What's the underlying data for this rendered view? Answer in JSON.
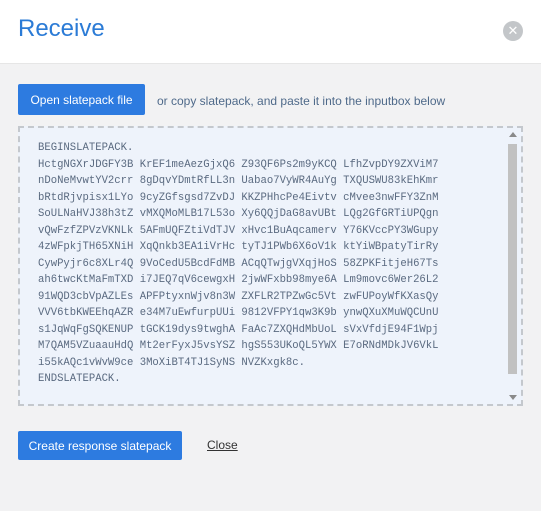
{
  "dialog": {
    "title": "Receive",
    "close_icon": "close-icon"
  },
  "actions": {
    "open_label": "Open slatepack file",
    "hint": "or copy slatepack, and paste it into the inputbox below",
    "create_label": "Create response slatepack",
    "close_label": "Close"
  },
  "inputbox": {
    "lines": [
      "BEGINSLATEPACK.",
      "HctgNGXrJDGFY3B KrEF1meAezGjxQ6 Z93QF6Ps2m9yKCQ LfhZvpDY9ZXViM7",
      "nDoNeMvwtYV2crr 8gDqvYDmtRfLL3n Uabao7VyWR4AuYg TXQUSWU83kEhKmr",
      "bRtdRjvpisx1LYo 9cyZGfsgsd7ZvDJ KKZPHhcPe4Eivtv cMvee3nwFFY3ZnM",
      "SoULNaHVJ38h3tZ vMXQMoMLB17L53o Xy6QQjDaG8avUBt LQg2GfGRTiUPQgn",
      "vQwFzfZPVzVKNLk 5AFmUQFZtiVdTJV xHvc1BuAqcamerv Y76KVccPY3WGupy",
      "4zWFpkjTH65XNiH XqQnkb3EA1iVrHc tyTJ1PWb6X6oV1k ktYiWBpatyTirRy",
      "CywPyjr6c8XLr4Q 9VoCedU5BcdFdMB ACqQTwjgVXqjHoS 58ZPKFitjeH67Ts",
      "ah6twcKtMaFmTXD i7JEQ7qV6cewgxH 2jwWFxbb98mye6A Lm9movc6Wer26L2",
      "91WQD3cbVpAZLEs APFPtyxnWjv8n3W ZXFLR2TPZwGc5Vt zwFUPoyWfKXasQy",
      "VVV6tbKWEEhqAZR e34M7uEwfurpUUi 9812VFPY1qw3K9b ynwQXuXMuWQCUnU",
      "s1JqWqFgSQKENUP tGCK19dys9twghA FaAc7ZXQHdMbUoL sVxVfdjE94F1Wpj",
      "M7QAM5VZuaauHdQ Mt2erFyxJ5vsYSZ hgS553UKoQL5YWX E7oRNdMDkJV6VkL",
      "i55kAQc1vWvW9ce 3MoXiBT4TJ1SyNS NVZKxgk8c.",
      "ENDSLATEPACK."
    ]
  },
  "colors": {
    "accent": "#2d7be0",
    "title": "#2b7bd6",
    "inputbox_bg": "#eef3fb"
  }
}
